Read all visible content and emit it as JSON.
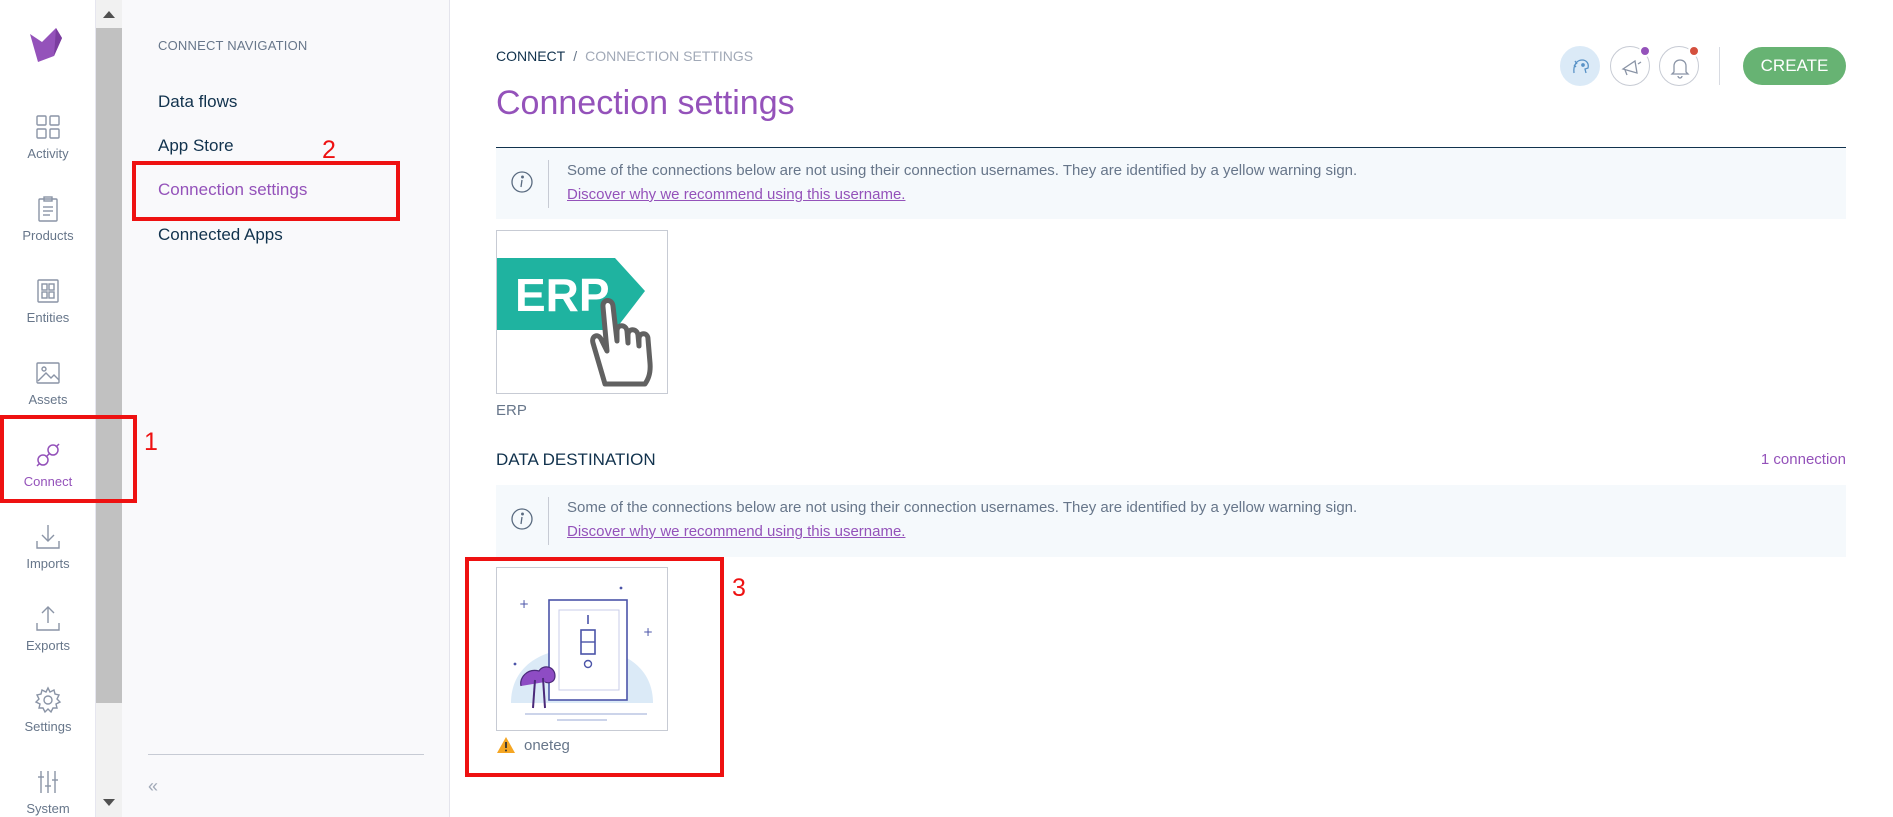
{
  "rail": {
    "items": [
      {
        "label": "Activity",
        "icon": "activity-icon"
      },
      {
        "label": "Products",
        "icon": "products-icon"
      },
      {
        "label": "Entities",
        "icon": "entities-icon"
      },
      {
        "label": "Assets",
        "icon": "assets-icon"
      },
      {
        "label": "Connect",
        "icon": "connect-icon",
        "active": true
      },
      {
        "label": "Imports",
        "icon": "imports-icon"
      },
      {
        "label": "Exports",
        "icon": "exports-icon"
      },
      {
        "label": "Settings",
        "icon": "settings-icon"
      },
      {
        "label": "System",
        "icon": "system-icon"
      }
    ]
  },
  "subnav": {
    "title": "CONNECT NAVIGATION",
    "items": [
      {
        "label": "Data flows"
      },
      {
        "label": "App Store"
      },
      {
        "label": "Connection settings",
        "active": true
      },
      {
        "label": "Connected Apps"
      }
    ],
    "collapse_glyph": "«"
  },
  "header": {
    "breadcrumb_root": "CONNECT",
    "breadcrumb_sep": "/",
    "breadcrumb_current": "CONNECTION SETTINGS",
    "title": "Connection settings",
    "create_label": "CREATE"
  },
  "info": {
    "message": "Some of the connections below are not using their connection usernames. They are identified by a yellow warning sign.",
    "link": "Discover why we recommend using this username."
  },
  "source": {
    "card_text": "ERP",
    "label": "ERP"
  },
  "destination": {
    "title": "DATA DESTINATION",
    "count": "1 connection",
    "card_label": "oneteg"
  },
  "annotations": [
    "1",
    "2",
    "3"
  ],
  "colors": {
    "accent": "#9452ba",
    "create": "#67b373",
    "erp": "#1fb3a0",
    "text": "#11324d",
    "muted": "#67768a",
    "annotation": "#ee1111",
    "warning": "#f5a623"
  }
}
